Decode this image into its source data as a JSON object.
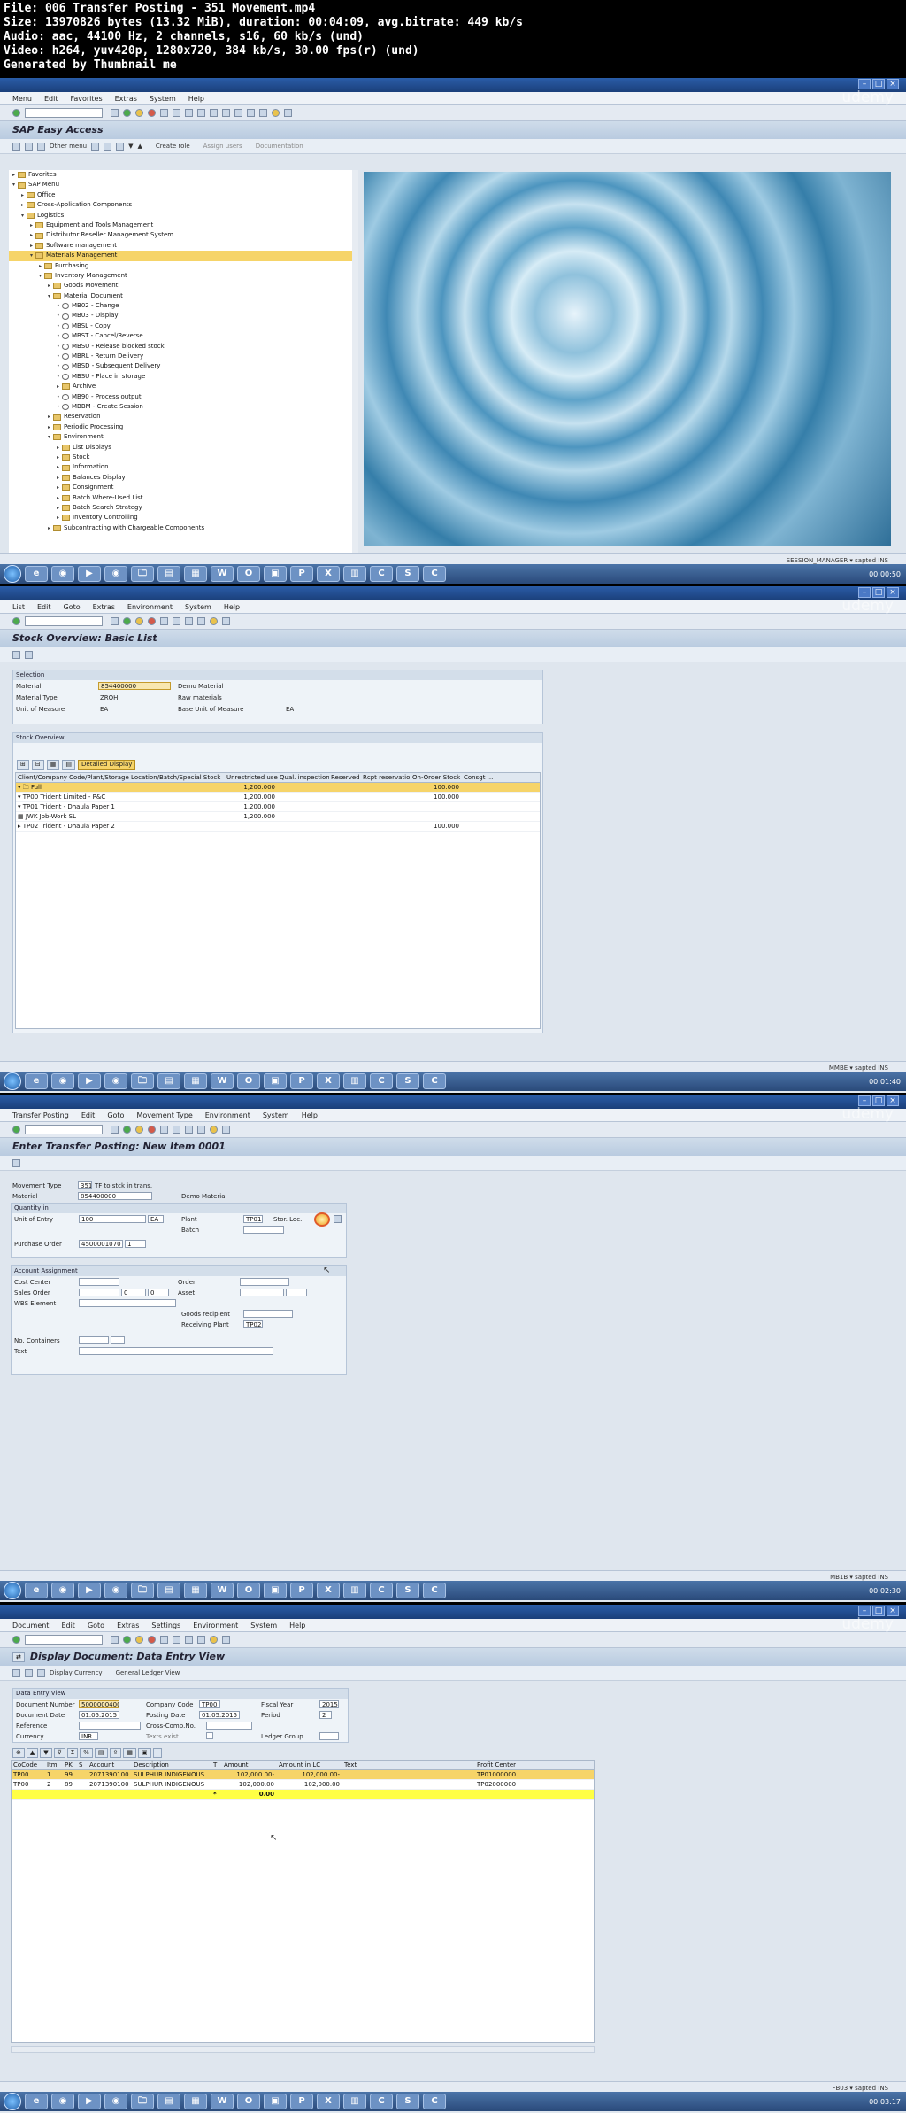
{
  "file_info": {
    "line1": "File: 006 Transfer Posting - 351 Movement.mp4",
    "line2": "Size: 13970826 bytes (13.32 MiB), duration: 00:04:09, avg.bitrate: 449 kb/s",
    "line3": "Audio: aac, 44100 Hz, 2 channels, s16, 60 kb/s (und)",
    "line4": "Video: h264, yuv420p, 1280x720, 384 kb/s, 30.00 fps(r) (und)",
    "line5": "Generated by Thumbnail me"
  },
  "frame1": {
    "menu": [
      "Menu",
      "Edit",
      "Favorites",
      "Extras",
      "System",
      "Help"
    ],
    "title": "SAP Easy Access",
    "app_toolbar": [
      "Other menu",
      "Create role",
      "Assign users",
      "Documentation"
    ],
    "tree": [
      {
        "label": "Favorites",
        "indent": 0,
        "kind": "folder",
        "tw": "▸"
      },
      {
        "label": "SAP Menu",
        "indent": 0,
        "kind": "folder",
        "tw": "▾"
      },
      {
        "label": "Office",
        "indent": 1,
        "kind": "folder",
        "tw": "▸"
      },
      {
        "label": "Cross-Application Components",
        "indent": 1,
        "kind": "folder",
        "tw": "▸"
      },
      {
        "label": "Logistics",
        "indent": 1,
        "kind": "folder",
        "tw": "▾"
      },
      {
        "label": "Equipment and Tools Management",
        "indent": 2,
        "kind": "folder",
        "tw": "▸"
      },
      {
        "label": "Distributor Reseller Management System",
        "indent": 2,
        "kind": "folder",
        "tw": "▸"
      },
      {
        "label": "Software management",
        "indent": 2,
        "kind": "folder",
        "tw": "▸"
      },
      {
        "label": "Materials Management",
        "indent": 2,
        "kind": "folder",
        "tw": "▾",
        "sel": true
      },
      {
        "label": "Purchasing",
        "indent": 3,
        "kind": "folder",
        "tw": "▸"
      },
      {
        "label": "Inventory Management",
        "indent": 3,
        "kind": "folder",
        "tw": "▾"
      },
      {
        "label": "Goods Movement",
        "indent": 4,
        "kind": "folder",
        "tw": "▸"
      },
      {
        "label": "Material Document",
        "indent": 4,
        "kind": "folder",
        "tw": "▾"
      },
      {
        "label": "MB02 - Change",
        "indent": 5,
        "kind": "tcode",
        "tw": "•"
      },
      {
        "label": "MB03 - Display",
        "indent": 5,
        "kind": "tcode",
        "tw": "•"
      },
      {
        "label": "MBSL - Copy",
        "indent": 5,
        "kind": "tcode",
        "tw": "•"
      },
      {
        "label": "MBST - Cancel/Reverse",
        "indent": 5,
        "kind": "tcode",
        "tw": "•"
      },
      {
        "label": "MBSU - Release blocked stock",
        "indent": 5,
        "kind": "tcode",
        "tw": "•"
      },
      {
        "label": "MBRL - Return Delivery",
        "indent": 5,
        "kind": "tcode",
        "tw": "•"
      },
      {
        "label": "MBSD - Subsequent Delivery",
        "indent": 5,
        "kind": "tcode",
        "tw": "•"
      },
      {
        "label": "MBSU - Place in storage",
        "indent": 5,
        "kind": "tcode",
        "tw": "•"
      },
      {
        "label": "Archive",
        "indent": 5,
        "kind": "folder",
        "tw": "▸"
      },
      {
        "label": "MB90 - Process output",
        "indent": 5,
        "kind": "tcode",
        "tw": "•"
      },
      {
        "label": "MBBM - Create Session",
        "indent": 5,
        "kind": "tcode",
        "tw": "•"
      },
      {
        "label": "Reservation",
        "indent": 4,
        "kind": "folder",
        "tw": "▸"
      },
      {
        "label": "Periodic Processing",
        "indent": 4,
        "kind": "folder",
        "tw": "▸"
      },
      {
        "label": "Environment",
        "indent": 4,
        "kind": "folder",
        "tw": "▾"
      },
      {
        "label": "List Displays",
        "indent": 5,
        "kind": "folder",
        "tw": "▸"
      },
      {
        "label": "Stock",
        "indent": 5,
        "kind": "folder",
        "tw": "▸"
      },
      {
        "label": "Information",
        "indent": 5,
        "kind": "folder",
        "tw": "▸"
      },
      {
        "label": "Balances Display",
        "indent": 5,
        "kind": "folder",
        "tw": "▸"
      },
      {
        "label": "Consignment",
        "indent": 5,
        "kind": "folder",
        "tw": "▸"
      },
      {
        "label": "Batch Where-Used List",
        "indent": 5,
        "kind": "folder",
        "tw": "▸"
      },
      {
        "label": "Batch Search Strategy",
        "indent": 5,
        "kind": "folder",
        "tw": "▸"
      },
      {
        "label": "Inventory Controlling",
        "indent": 5,
        "kind": "folder",
        "tw": "▸"
      },
      {
        "label": "Subcontracting with Chargeable Components",
        "indent": 4,
        "kind": "folder",
        "tw": "▸"
      }
    ],
    "status": "SESSION_MANAGER ▾  sapted  INS"
  },
  "frame2": {
    "menu": [
      "List",
      "Edit",
      "Goto",
      "Extras",
      "Environment",
      "System",
      "Help"
    ],
    "title": "Stock Overview: Basic List",
    "selection_header": "Selection",
    "material_label": "Material",
    "material_value": "854400000",
    "material_desc": "Demo Material",
    "material_type_label": "Material Type",
    "material_type_value": "ZROH",
    "material_type_desc": "Raw materials",
    "uom_label": "Unit of Measure",
    "uom_value": "EA",
    "base_uom_label": "Base Unit of Measure",
    "base_uom_value": "EA",
    "overview_header": "Stock Overview",
    "detail_btn": "Detailed Display",
    "columns": [
      "Client/Company Code/Plant/Storage Location/Batch/Special Stock",
      "Unrestricted use",
      "Qual. inspection",
      "Reserved",
      "Rcpt reservation",
      "On-Order Stock",
      "Consgt ..."
    ],
    "rows": [
      {
        "c0": "▾ 🗀 Full",
        "c1": "1,200.000",
        "c5": "100.000",
        "y": true
      },
      {
        "c0": "   ▾ TP00 Trident Limited - P&C",
        "c1": "1,200.000",
        "c5": "100.000"
      },
      {
        "c0": "      ▾ TP01 Trident - Dhaula Paper 1",
        "c1": "1,200.000",
        "c5": ""
      },
      {
        "c0": "         ▦ JWK Job-Work SL",
        "c1": "1,200.000",
        "c5": ""
      },
      {
        "c0": "      ▸ TP02 Trident - Dhaula Paper 2",
        "c1": "",
        "c5": "100.000"
      }
    ],
    "status": "MMBE ▾  sapted  INS"
  },
  "frame3": {
    "menu": [
      "Transfer Posting",
      "Edit",
      "Goto",
      "Movement Type",
      "Environment",
      "System",
      "Help"
    ],
    "title": "Enter Transfer Posting: New Item 0001",
    "mvt_label": "Movement Type",
    "mvt_value": "351",
    "mvt_desc": "TF to stck in trans.",
    "material_label": "Material",
    "material_value": "854400000",
    "material_desc": "Demo Material",
    "qty_header": "Quantity in",
    "uoe_label": "Unit of Entry",
    "uoe_value": "100",
    "uoe_unit": "EA",
    "plant_label": "Plant",
    "plant_value": "TP01",
    "sloc_label": "Stor. Loc.",
    "batch_label": "Batch",
    "po_label": "Purchase Order",
    "po_value": "4500001070",
    "po_item": "1",
    "acct_header": "Account Assignment",
    "cost_center": "Cost Center",
    "order": "Order",
    "sales_order": "Sales Order",
    "so_item": "0",
    "so_sched": "0",
    "asset": "Asset",
    "wbs": "WBS Element",
    "goods_recipient": "Goods recipient",
    "receiving_plant": "Receiving Plant",
    "receiving_plant_value": "TP02",
    "containers": "No. Containers",
    "text": "Text",
    "status": "MB1B ▾  sapted  INS"
  },
  "frame4": {
    "menu": [
      "Document",
      "Edit",
      "Goto",
      "Extras",
      "Settings",
      "Environment",
      "System",
      "Help"
    ],
    "title": "Display Document: Data Entry View",
    "btn_currency": "Display Currency",
    "btn_gl": "General Ledger View",
    "dev_header": "Data Entry View",
    "docnum_label": "Document Number",
    "docnum_value": "5000000400",
    "cocode_label": "Company Code",
    "cocode_value": "TP00",
    "fy_label": "Fiscal Year",
    "fy_value": "2015",
    "docdate_label": "Document Date",
    "docdate_value": "01.05.2015",
    "postdate_label": "Posting Date",
    "postdate_value": "01.05.2015",
    "period_label": "Period",
    "period_value": "2",
    "ref_label": "Reference",
    "crosscomp_label": "Cross-Comp.No.",
    "currency_label": "Currency",
    "currency_value": "INR",
    "texts_label": "Texts exist",
    "ledger_label": "Ledger Group",
    "columns": [
      "CoCode",
      "Itm",
      "PK",
      "S",
      "Account",
      "Description",
      "T",
      "Amount",
      "Amount in LC",
      "Text",
      "Profit Center"
    ],
    "rows": [
      {
        "c": [
          "TP00",
          "1",
          "99",
          "",
          "2071390100",
          "SULPHUR INDIGENOUS",
          "",
          "102,000.00-",
          "102,000.00-",
          "",
          "TP01000000"
        ],
        "y": true
      },
      {
        "c": [
          "TP00",
          "2",
          "89",
          "",
          "2071390100",
          "SULPHUR INDIGENOUS",
          "",
          "102,000.00",
          "102,000.00",
          "",
          "TP02000000"
        ]
      },
      {
        "c": [
          "",
          "",
          "",
          "",
          "",
          "",
          "*",
          "0.00",
          "",
          "",
          ""
        ],
        "yy": true
      }
    ],
    "status": "FB03 ▾  sapted  INS"
  },
  "taskbar": [
    "e",
    "◉",
    "▶",
    "◉",
    "🗀",
    "▤",
    "▦",
    "W",
    "O",
    "▣",
    "P",
    "X",
    "▥",
    "C",
    "S",
    "C"
  ],
  "watermark": "udemy",
  "timestamps": [
    "00:00:50",
    "00:01:40",
    "00:02:30",
    "00:03:17"
  ]
}
